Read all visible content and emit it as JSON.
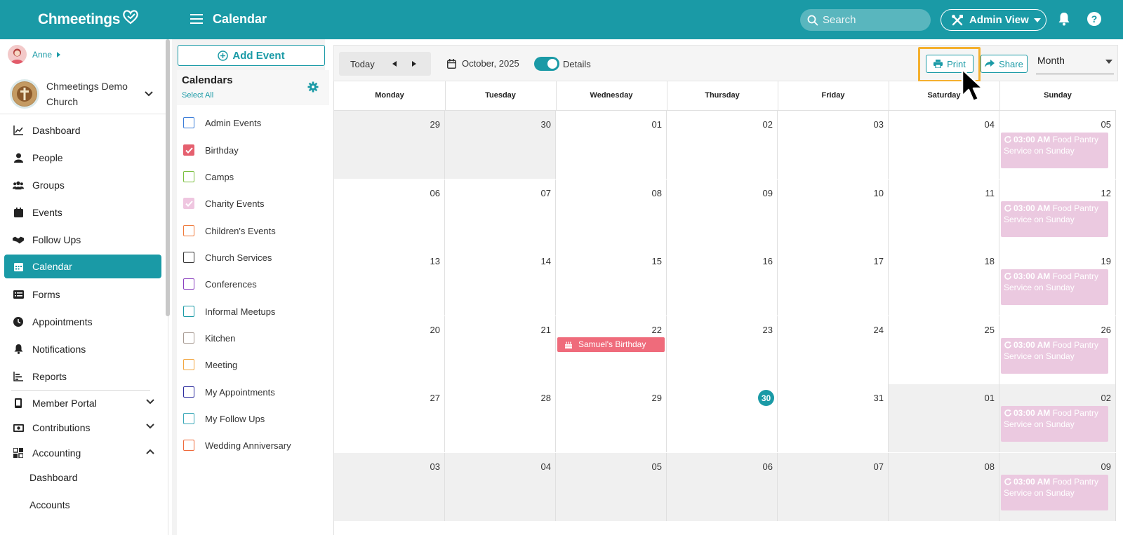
{
  "app": {
    "brand": "Chmeetings",
    "page_title": "Calendar"
  },
  "header": {
    "search_placeholder": "Search",
    "admin_view_label": "Admin View"
  },
  "user": {
    "name": "Anne",
    "church_name": "Chmeetings Demo Church"
  },
  "nav": {
    "items": [
      {
        "label": "Dashboard",
        "icon": "chart-line-icon"
      },
      {
        "label": "People",
        "icon": "person-icon"
      },
      {
        "label": "Groups",
        "icon": "group-icon"
      },
      {
        "label": "Events",
        "icon": "calendar-icon"
      },
      {
        "label": "Follow Ups",
        "icon": "handshake-icon"
      },
      {
        "label": "Calendar",
        "icon": "calendar-grid-icon",
        "active": true
      },
      {
        "label": "Forms",
        "icon": "form-icon"
      },
      {
        "label": "Appointments",
        "icon": "clock-icon"
      },
      {
        "label": "Notifications",
        "icon": "bell-icon"
      },
      {
        "label": "Reports",
        "icon": "bar-chart-icon"
      }
    ],
    "sections": [
      {
        "label": "Member Portal",
        "icon": "mobile-icon",
        "expanded": false
      },
      {
        "label": "Contributions",
        "icon": "money-icon",
        "expanded": false
      },
      {
        "label": "Accounting",
        "icon": "accounting-icon",
        "expanded": true
      }
    ],
    "accounting_sub": [
      "Dashboard",
      "Accounts"
    ]
  },
  "calendars_panel": {
    "add_event_label": "Add Event",
    "title": "Calendars",
    "select_all": "Select All",
    "items": [
      {
        "label": "Admin Events",
        "color": "#3b7dd8",
        "checked": false
      },
      {
        "label": "Birthday",
        "color": "#e5606f",
        "checked": true
      },
      {
        "label": "Camps",
        "color": "#7bbf3f",
        "checked": false
      },
      {
        "label": "Charity Events",
        "color": "#efc6e0",
        "checked": true
      },
      {
        "label": "Children's Events",
        "color": "#ef7a3b",
        "checked": false
      },
      {
        "label": "Church Services",
        "color": "#333333",
        "checked": false
      },
      {
        "label": "Conferences",
        "color": "#8a3fbf",
        "checked": false
      },
      {
        "label": "Informal Meetups",
        "color": "#1a9aa6",
        "checked": false
      },
      {
        "label": "Kitchen",
        "color": "#a89b93",
        "checked": false
      },
      {
        "label": "Meeting",
        "color": "#f2a640",
        "checked": false
      },
      {
        "label": "My Appointments",
        "color": "#2d2d9e",
        "checked": false
      },
      {
        "label": "My Follow Ups",
        "color": "#3aa8b8",
        "checked": false
      },
      {
        "label": "Wedding Anniversary",
        "color": "#ef6a3b",
        "checked": false
      }
    ]
  },
  "toolbar": {
    "today_label": "Today",
    "current_month": "October, 2025",
    "details_label": "Details",
    "details_on": true,
    "print_label": "Print",
    "share_label": "Share",
    "view_label": "Month"
  },
  "calendar": {
    "weekdays": [
      "Monday",
      "Tuesday",
      "Wednesday",
      "Thursday",
      "Friday",
      "Saturday",
      "Sunday"
    ],
    "weeks": [
      [
        "29",
        "30",
        "01",
        "02",
        "03",
        "04",
        "05"
      ],
      [
        "06",
        "07",
        "08",
        "09",
        "10",
        "11",
        "12"
      ],
      [
        "13",
        "14",
        "15",
        "16",
        "17",
        "18",
        "19"
      ],
      [
        "20",
        "21",
        "22",
        "23",
        "24",
        "25",
        "26"
      ],
      [
        "27",
        "28",
        "29",
        "30",
        "31",
        "01",
        "02"
      ],
      [
        "03",
        "04",
        "05",
        "06",
        "07",
        "08",
        "09"
      ]
    ],
    "muted_cells": [
      [
        0,
        0
      ],
      [
        0,
        1
      ],
      [
        4,
        5
      ],
      [
        4,
        6
      ],
      [
        5,
        0
      ],
      [
        5,
        1
      ],
      [
        5,
        2
      ],
      [
        5,
        3
      ],
      [
        5,
        4
      ],
      [
        5,
        5
      ],
      [
        5,
        6
      ]
    ],
    "today_cell": [
      4,
      3
    ],
    "sunday_event": {
      "time": "03:00 AM",
      "title": "Food Pantry Service on Sunday"
    },
    "birthday_event": {
      "title": "Samuel's Birthday",
      "cell": [
        3,
        2
      ]
    }
  },
  "colors": {
    "brand": "#1a9aa6",
    "highlight": "#f4b02e",
    "charity_event": "#ebc9e0",
    "birthday_event": "#ef6b7b"
  }
}
